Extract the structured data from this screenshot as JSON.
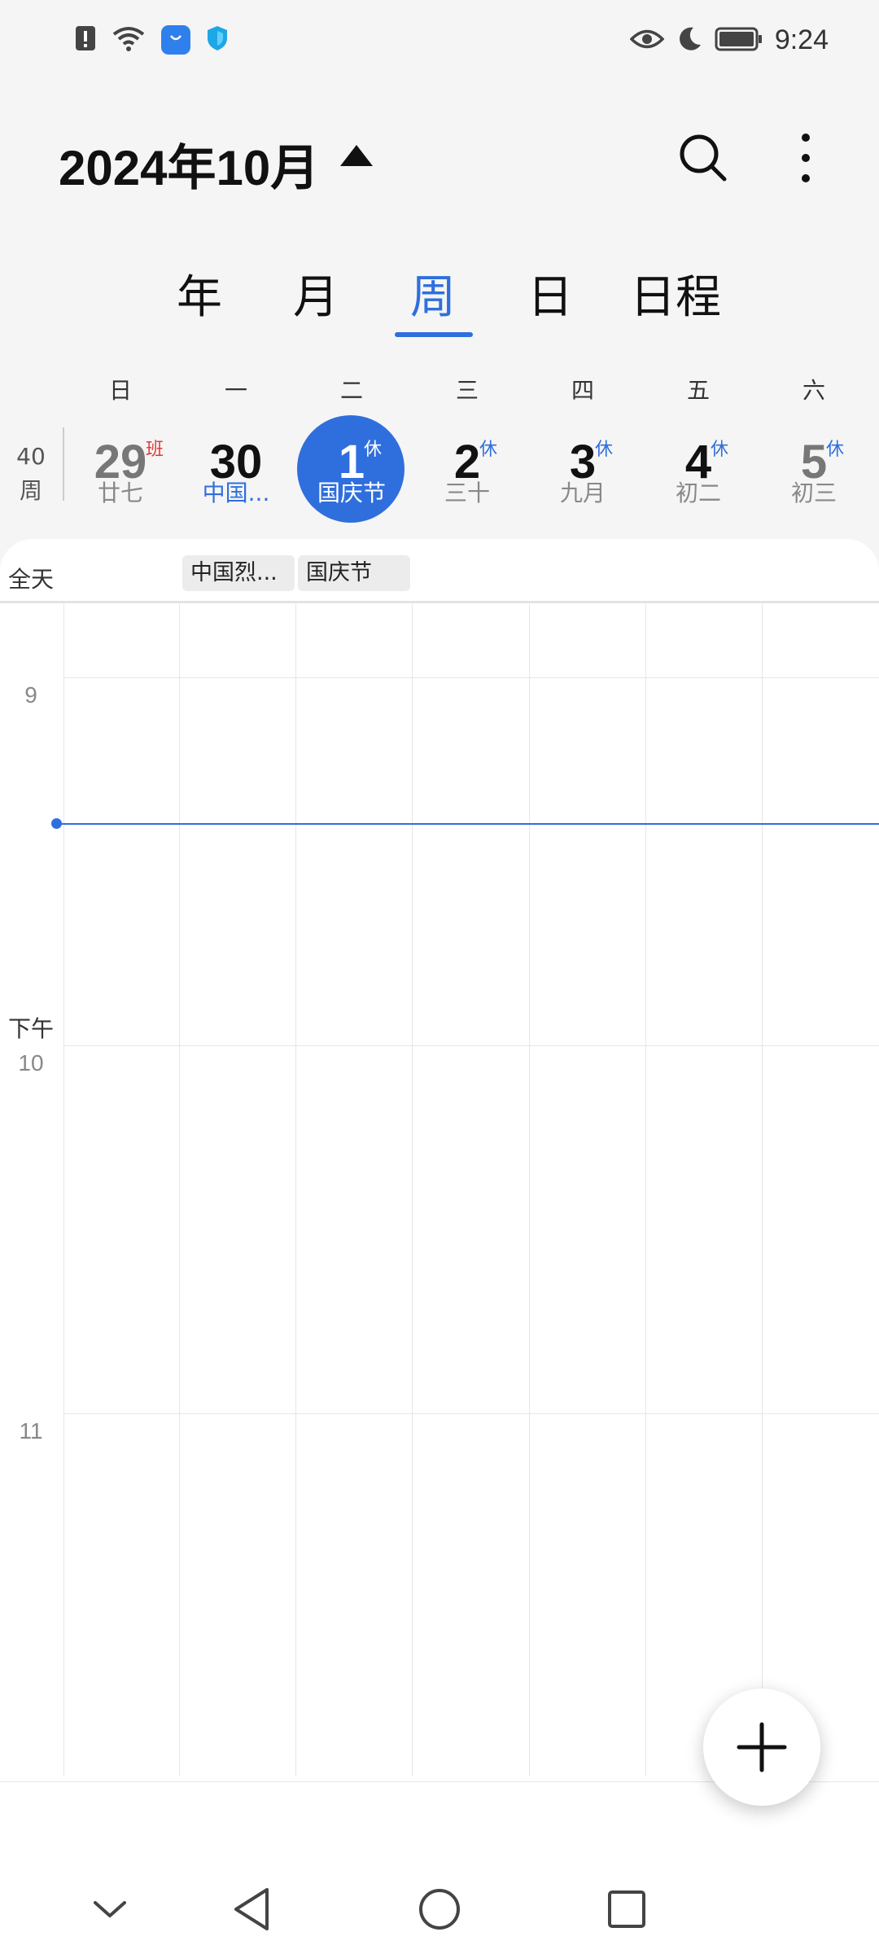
{
  "status_bar": {
    "time": "9:24",
    "left_icons": [
      "alert-icon",
      "wifi-icon",
      "app-store-icon",
      "shield-icon"
    ],
    "right_icons": [
      "eye-icon",
      "moon-icon",
      "battery-icon"
    ]
  },
  "header": {
    "title": "2024年10月",
    "icons": [
      "search-icon",
      "more-icon"
    ]
  },
  "tabs": [
    {
      "label": "年"
    },
    {
      "label": "月"
    },
    {
      "label": "周",
      "active": true
    },
    {
      "label": "日"
    },
    {
      "label": "日程"
    }
  ],
  "week": {
    "number": "40",
    "suffix": "周",
    "weekday_labels": [
      "日",
      "一",
      "二",
      "三",
      "四",
      "五",
      "六"
    ],
    "days": [
      {
        "num": "29",
        "badge": "班",
        "sub": "廿七"
      },
      {
        "num": "30",
        "badge": "",
        "sub": "中国..."
      },
      {
        "num": "1",
        "badge": "休",
        "sub": "国庆节"
      },
      {
        "num": "2",
        "badge": "休",
        "sub": "三十"
      },
      {
        "num": "3",
        "badge": "休",
        "sub": "九月"
      },
      {
        "num": "4",
        "badge": "休",
        "sub": "初二"
      },
      {
        "num": "5",
        "badge": "休",
        "sub": "初三"
      }
    ]
  },
  "allday": {
    "label": "全天",
    "events": [
      "中国烈...",
      "国庆节"
    ]
  },
  "timeline": {
    "ampm": "下午",
    "hours": [
      "9",
      "10",
      "11"
    ]
  },
  "colors": {
    "accent": "#2f6fdd",
    "workday_badge": "#e53935",
    "holiday_badge": "#2f6fdd"
  },
  "fab": {
    "icon": "plus-icon"
  },
  "navbar": {
    "icons": [
      "chevron-down-icon",
      "back-icon",
      "home-icon",
      "recents-icon"
    ]
  }
}
